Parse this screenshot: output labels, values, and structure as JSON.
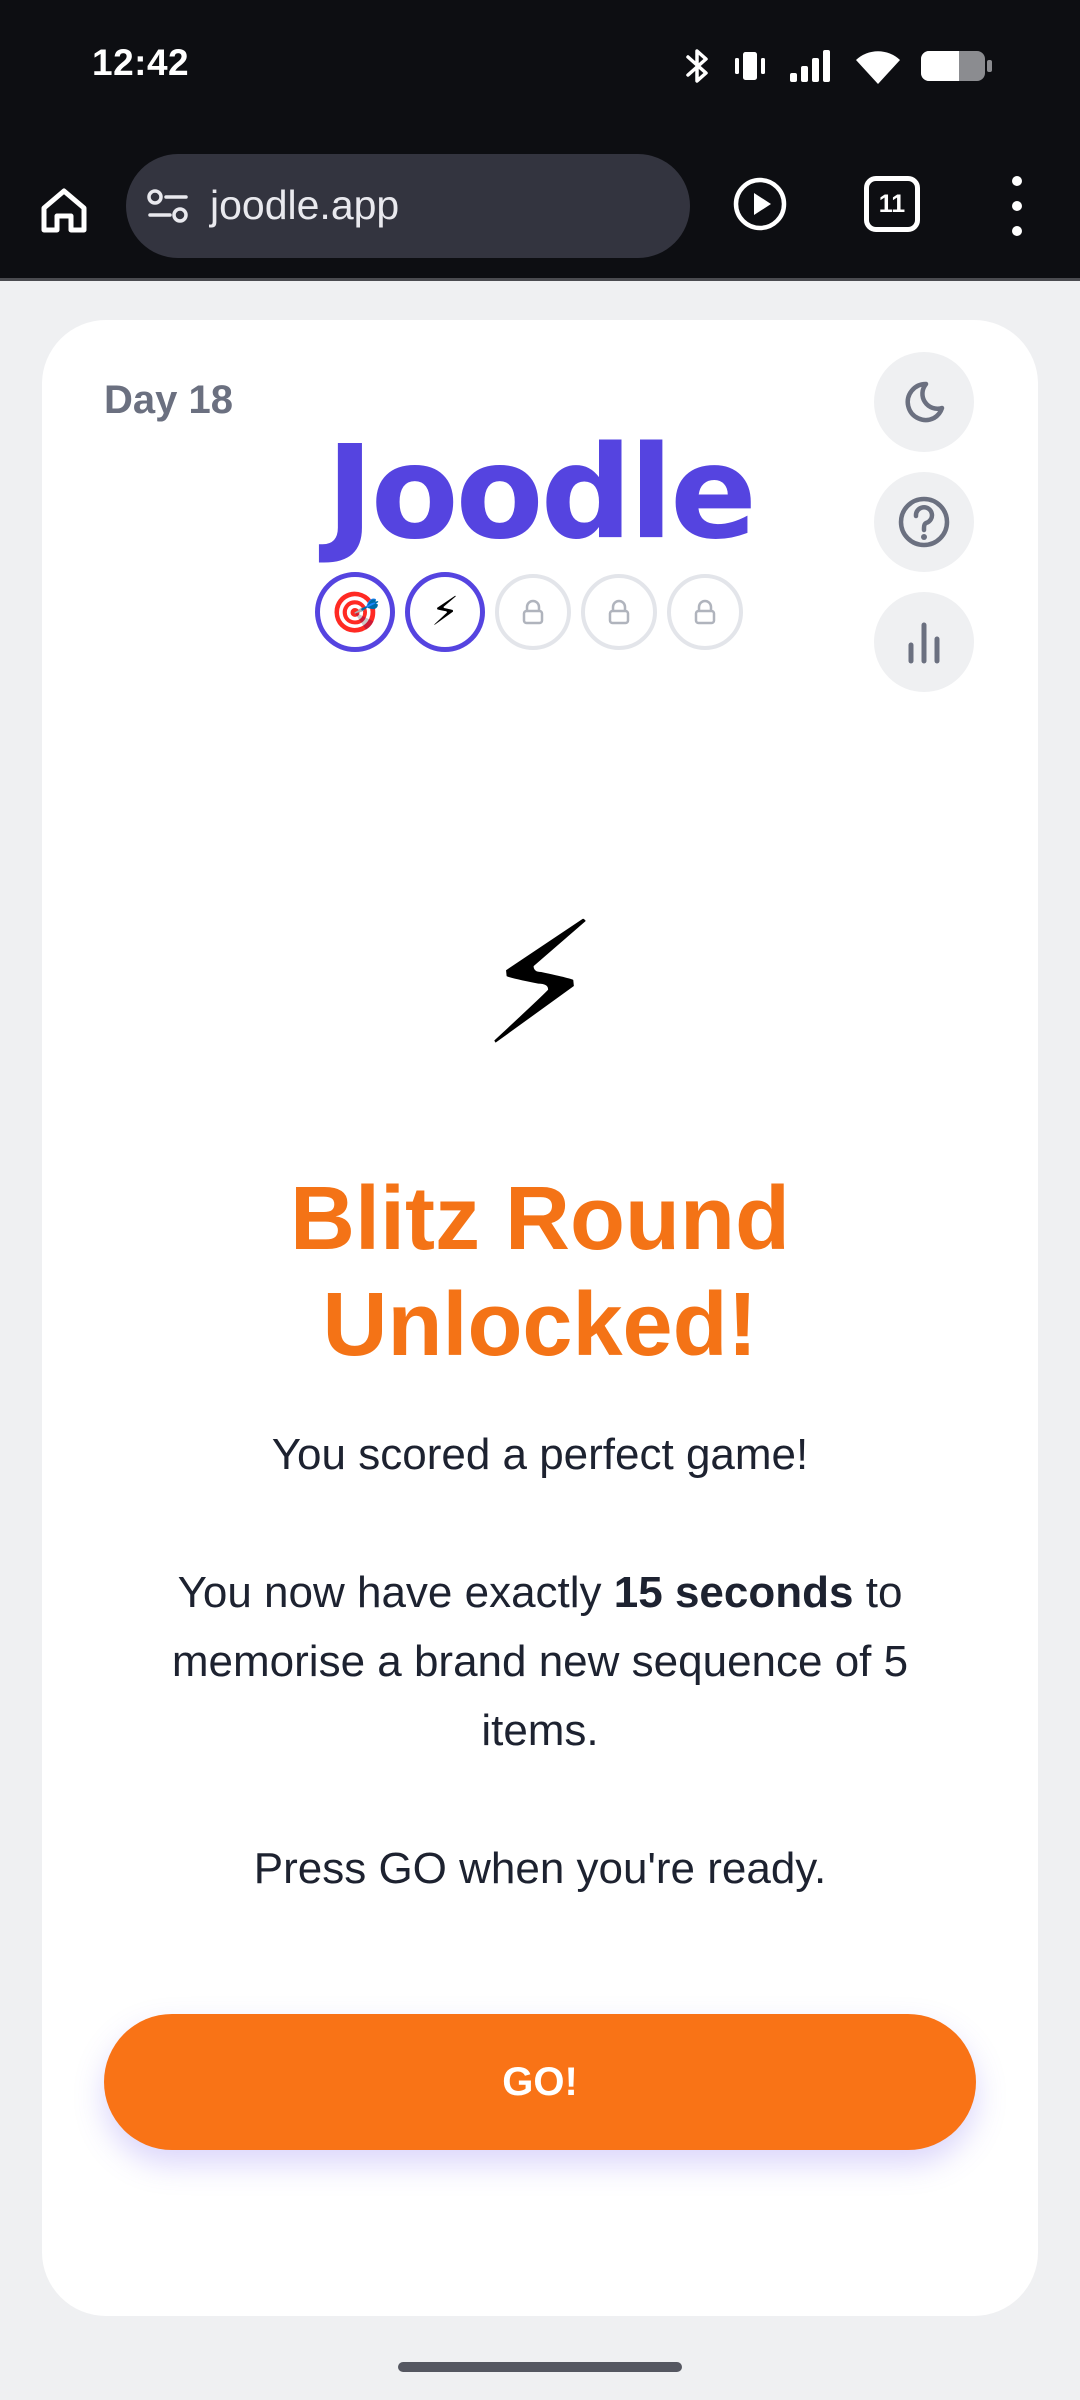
{
  "status_bar": {
    "time": "12:42",
    "icons": [
      "bluetooth-icon",
      "vibrate-icon",
      "signal-icon",
      "wifi-icon",
      "battery-icon"
    ]
  },
  "browser": {
    "url": "joodle.app",
    "tab_count": "11"
  },
  "game": {
    "day_label": "Day 18",
    "logo": "Joodle",
    "logo_color": "#5544e0",
    "badges": [
      {
        "icon": "🎯",
        "state": "active"
      },
      {
        "icon": "⚡",
        "state": "active"
      },
      {
        "icon": "lock-icon",
        "state": "locked"
      },
      {
        "icon": "lock-icon",
        "state": "locked"
      },
      {
        "icon": "lock-icon",
        "state": "locked"
      }
    ],
    "hero_icon": "⚡",
    "title_line1": "Blitz Round",
    "title_line2": "Unlocked!",
    "title_color": "#f47316",
    "message1": "You scored a perfect game!",
    "message2_before": "You now have exactly",
    "message2_bold": "15 seconds",
    "message2_after": "to memorise a brand new sequence of 5 items.",
    "message3": "Press GO when you're ready.",
    "go_label": "GO!",
    "go_color": "#f97316"
  }
}
